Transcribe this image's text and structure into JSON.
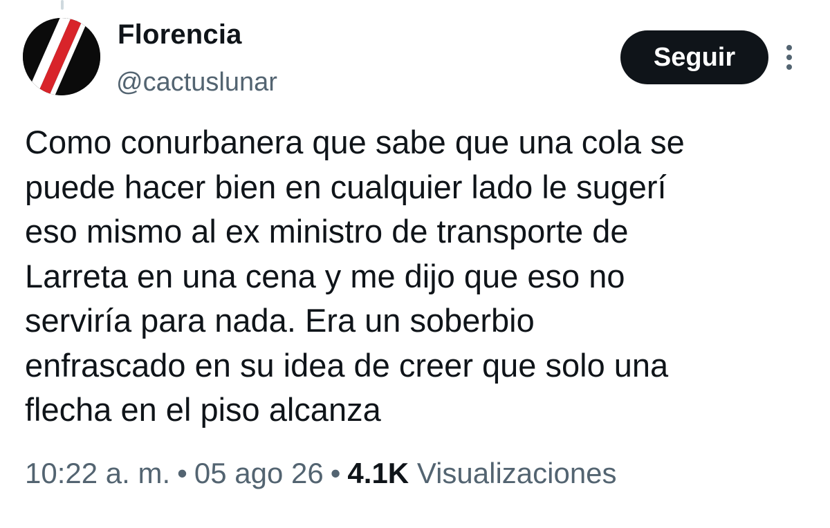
{
  "author": {
    "display_name": "Florencia",
    "handle": "@cactuslunar",
    "avatar_colors": {
      "background": "#0b0b0b",
      "stripe_red": "#d8242a",
      "stripe_white": "#ffffff"
    }
  },
  "actions": {
    "follow_label": "Seguir",
    "more_icon": "more-vertical-icon"
  },
  "tweet": {
    "text": "Como conurbanera que sabe que una cola se\npuede hacer bien en cualquier lado le sugerí\neso mismo al ex ministro de transporte de\nLarreta en una cena y me dijo que eso no\nserviría para nada. Era un soberbio\nenfrascado en su idea de creer que solo una\nflecha en el piso alcanza"
  },
  "meta": {
    "time": "10:22 a. m.",
    "separator": "•",
    "date": "05 ago 26",
    "views_count": "4.1K",
    "views_label": "Visualizaciones"
  },
  "colors": {
    "text_primary": "#0f1419",
    "text_secondary": "#536471",
    "button_bg": "#0f1419"
  }
}
